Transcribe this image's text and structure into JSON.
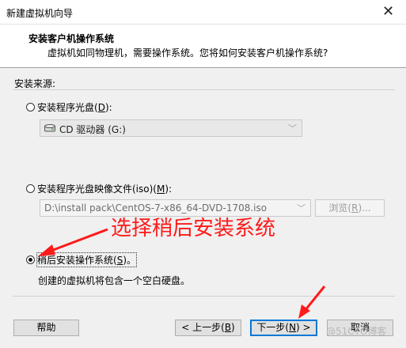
{
  "window": {
    "title": "新建虚拟机向导",
    "close": "✕"
  },
  "header": {
    "title": "安装客户机操作系统",
    "subtitle": "虚拟机如同物理机，需要操作系统。您将如何安装客户机操作系统?"
  },
  "source_label": "安装来源:",
  "options": {
    "disc": {
      "label": "安装程序光盘(",
      "key": "D",
      "suffix": "):",
      "selected": false
    },
    "iso": {
      "label": "安装程序光盘映像文件(iso)(",
      "key": "M",
      "suffix": "):",
      "selected": false
    },
    "later": {
      "label": "稍后安装操作系统(",
      "key": "S",
      "suffix": ")。",
      "selected": true
    }
  },
  "drive_select": {
    "value": "CD 驱动器 (G:)"
  },
  "iso_path": {
    "value": "D:\\install pack\\CentOS-7-x86_64-DVD-1708.iso"
  },
  "browse_button": {
    "label": "浏览(",
    "key": "R",
    "suffix": ")..."
  },
  "later_description": "创建的虚拟机将包含一个空白硬盘。",
  "annotation": "选择稍后安装系统",
  "buttons": {
    "help": "帮助",
    "back": {
      "label": "< 上一步(",
      "key": "B",
      "suffix": ")"
    },
    "next": {
      "label": "下一步(",
      "key": "N",
      "suffix": ") >"
    },
    "cancel": "取消"
  },
  "watermark": "@51CTO博客",
  "colors": {
    "annotation": "#ff1a1a",
    "primary_border": "#0078d7"
  }
}
